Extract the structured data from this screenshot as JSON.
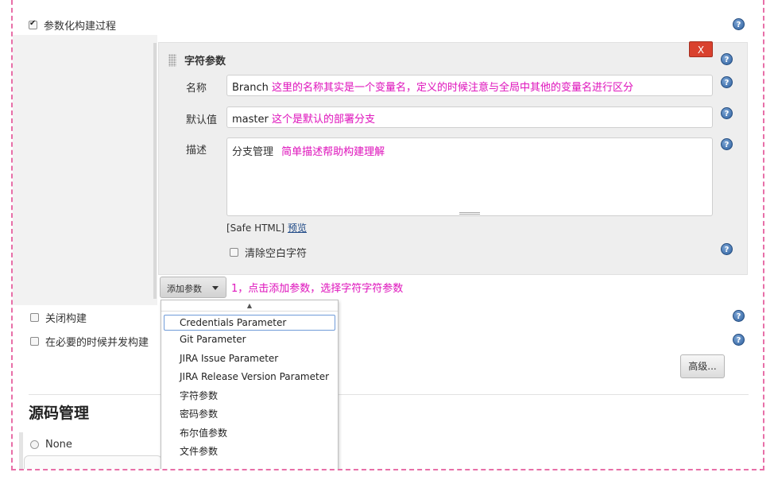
{
  "build": {
    "parameterized_label": "参数化构建过程",
    "parameter": {
      "title": "字符参数",
      "delete_label": "X",
      "name_label": "名称",
      "name_value": "Branch",
      "name_annotation": "这里的名称其实是一个变量名，定义的时候注意与全局中其他的变量名进行区分",
      "default_label": "默认值",
      "default_value": "master",
      "default_annotation": "这个是默认的部署分支",
      "desc_label": "描述",
      "desc_value": "分支管理",
      "desc_annotation": "简单描述帮助构建理解",
      "safe_html": "[Safe HTML]",
      "preview_link": "预览",
      "trim_label": "清除空白字符"
    },
    "add_param_label": "添加参数",
    "add_param_annotation": "1，点击添加参数，选择字符字符参数",
    "dropdown": {
      "items": [
        "Credentials Parameter",
        "Git Parameter",
        "JIRA Issue Parameter",
        "JIRA Release Version Parameter",
        "字符参数",
        "密码参数",
        "布尔值参数",
        "文件参数"
      ]
    },
    "disable_build_label": "关闭构建",
    "concurrent_build_label": "在必要的时候并发构建",
    "advanced_label": "高级..."
  },
  "scm": {
    "title": "源码管理",
    "none_label": "None"
  },
  "help_symbol": "?"
}
